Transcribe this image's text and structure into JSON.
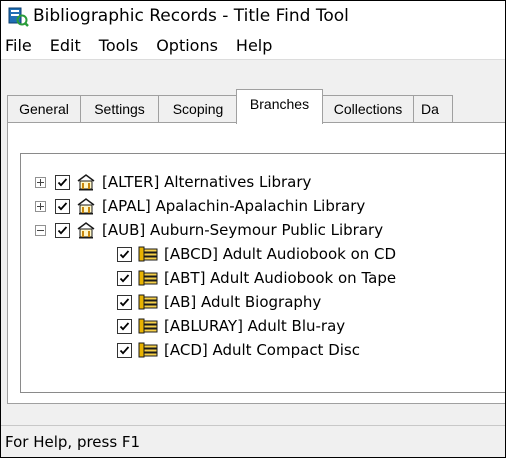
{
  "window": {
    "title": "Bibliographic Records - Title Find Tool"
  },
  "menu": {
    "items": [
      "File",
      "Edit",
      "Tools",
      "Options",
      "Help"
    ]
  },
  "tabs": [
    {
      "label": "General",
      "active": false
    },
    {
      "label": "Settings",
      "active": false
    },
    {
      "label": "Scoping",
      "active": false
    },
    {
      "label": "Branches",
      "active": true
    },
    {
      "label": "Collections",
      "active": false
    },
    {
      "label": "Da",
      "active": false
    }
  ],
  "tree": {
    "nodes": [
      {
        "level": 0,
        "expander": "plus",
        "checked": true,
        "icon": "library-icon",
        "label": "[ALTER] Alternatives Library"
      },
      {
        "level": 0,
        "expander": "plus",
        "checked": true,
        "icon": "library-icon",
        "label": "[APAL] Apalachin-Apalachin Library"
      },
      {
        "level": 0,
        "expander": "minus",
        "checked": true,
        "icon": "library-icon",
        "label": "[AUB] Auburn-Seymour Public Library"
      },
      {
        "level": 1,
        "checked": true,
        "icon": "collection-icon",
        "label": "[ABCD] Adult Audiobook on CD"
      },
      {
        "level": 1,
        "checked": true,
        "icon": "collection-icon",
        "label": "[ABT] Adult Audiobook on Tape"
      },
      {
        "level": 1,
        "checked": true,
        "icon": "collection-icon",
        "label": "[AB] Adult Biography"
      },
      {
        "level": 1,
        "checked": true,
        "icon": "collection-icon",
        "label": "[ABLURAY] Adult Blu-ray"
      },
      {
        "level": 1,
        "checked": true,
        "icon": "collection-icon",
        "label": "[ACD] Adult Compact Disc"
      }
    ]
  },
  "status": {
    "text": "For Help, press F1"
  }
}
